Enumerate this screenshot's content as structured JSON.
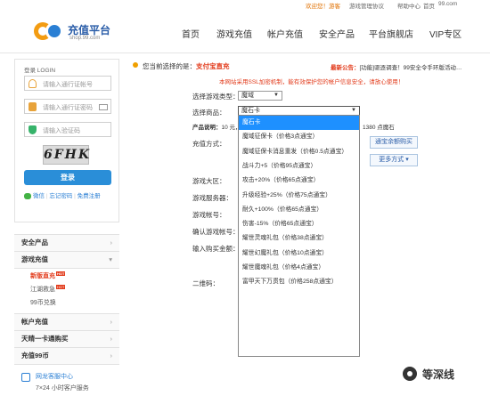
{
  "topbar": {
    "welcome": "欢迎您！游客",
    "items": [
      "游戏管理协议",
      "帮助中心",
      "首页",
      "99.com"
    ]
  },
  "header": {
    "logo_name": "充值平台",
    "logo_sub": "shop.99.com",
    "nav": [
      "首页",
      "游戏充值",
      "帐户充值",
      "安全产品",
      "平台旗舰店",
      "VIP专区"
    ]
  },
  "login": {
    "title": "登录 LOGIN",
    "account_placeholder": "请输入通行证帐号",
    "password_placeholder": "请输入通行证密码",
    "captcha_placeholder": "请输入验证码",
    "captcha_text": "6FHK",
    "login_button": "登录",
    "links": [
      "微信",
      "忘记密码",
      "免费注册"
    ]
  },
  "menu": {
    "sections": [
      "安全产品",
      "游戏充值",
      "帐户充值",
      "天晴一卡通购买",
      "充值99币"
    ],
    "game_subitems": [
      "新版直充",
      "江湖救急",
      "99币兑换"
    ],
    "hot_badge": "HOT",
    "service_title": "网龙客服中心",
    "service_hours": "7×24 小时客户服务"
  },
  "main": {
    "notice_prefix": "您当前选择的是：",
    "notice_value": "支付宝直充",
    "announcement_key": "最新公告：",
    "announcement_text": "[功能]驱逐调查！99安全令手环版活动…",
    "red_line": "本网站采用SSL加密机制，能有效保护您的帐户信息安全，请放心使用！",
    "game_type_label": "选择游戏类型：",
    "game_type_value": "魔域",
    "product_label": "选择商品：",
    "product_value": "魔石卡",
    "product_desc_label": "产品说明：",
    "product_desc_text": "10 元，",
    "product_desc_tail": "1380 点魔石",
    "pay_label": "充值方式：",
    "balance_button": "通宝余额购买",
    "more_button": "更多方式",
    "region_label": "游戏大区：",
    "server_label": "游戏服务器：",
    "account_label": "游戏帐号：",
    "confirm_account_label": "确认游戏帐号：",
    "amount_label": "输入购买金额：",
    "qrcode_label": "二维码："
  },
  "dropdown": {
    "items": [
      "魔石卡",
      "魔域征保卡（价格3点通宝）",
      "魔域征保卡消息重发（价格0.5点通宝）",
      "战斗力+5（价格95点通宝）",
      "攻击+20%（价格65点通宝）",
      "升级经验+25%（价格75点通宝）",
      "耐久+100%（价格65点通宝）",
      "伤害-15%（价格65点通宝）",
      "耀世灵魂礼包（价格38点通宝）",
      "耀世幻魔礼包（价格10点通宝）",
      "耀世魔魂礼包（价格4点通宝）",
      "富甲天下万贯包（价格258点通宝）"
    ],
    "selected_index": 0
  },
  "watermark": "等深线",
  "colors": {
    "accent": "#2a8ed8",
    "red": "#e23a1a",
    "orange": "#f0a000",
    "select": "#1e90ff"
  }
}
